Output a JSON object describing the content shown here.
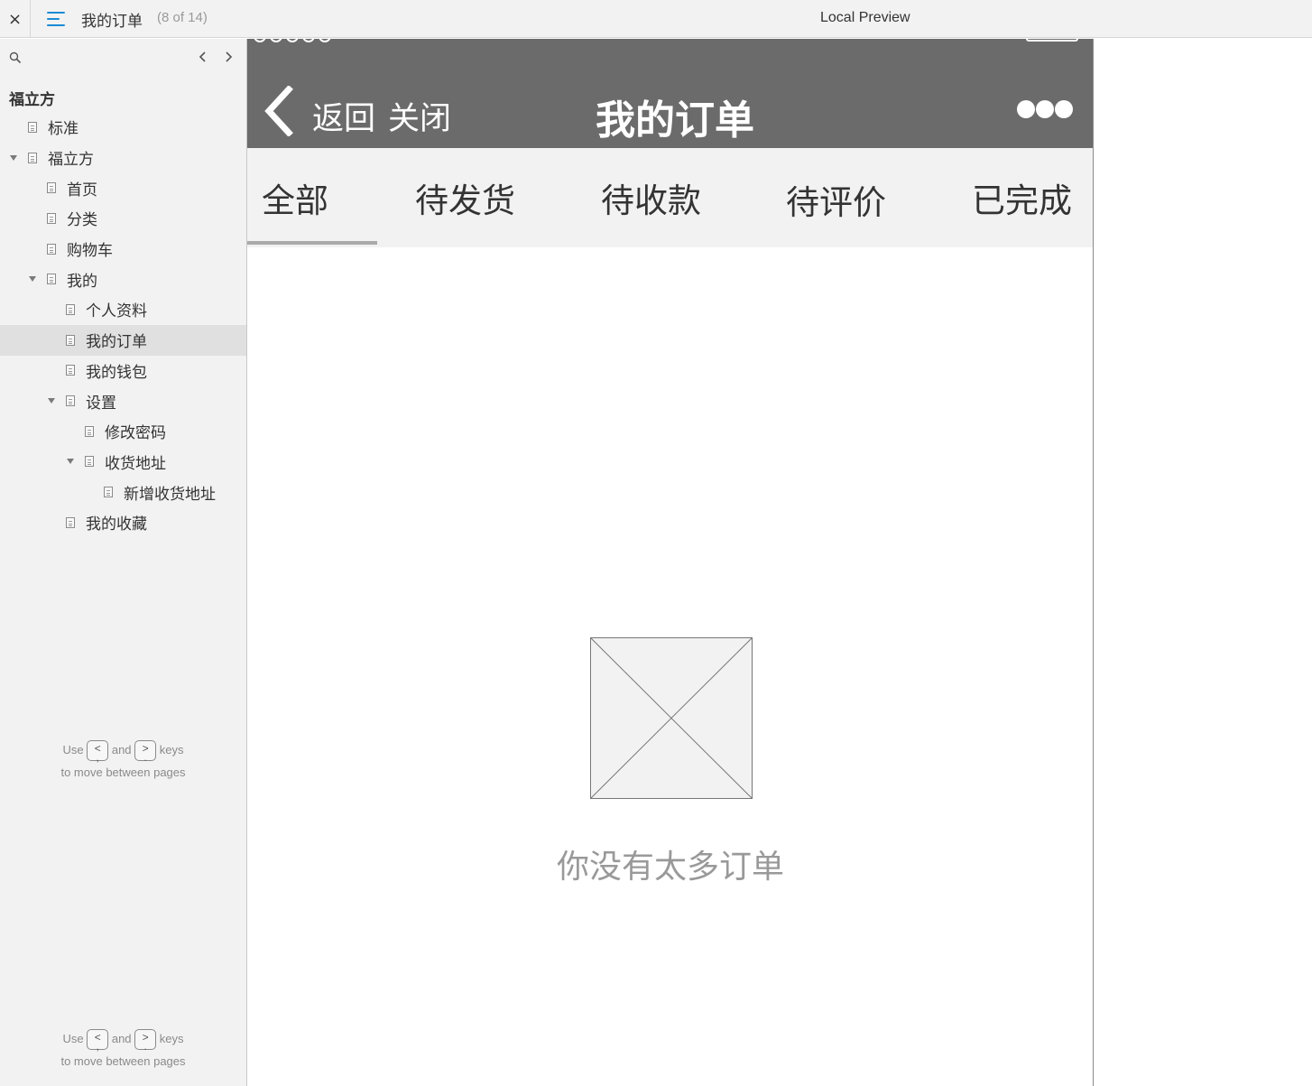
{
  "topbar": {
    "close_glyph": "×",
    "page_title": "我的订单",
    "page_count": "(8 of 14)",
    "preview_title": "Local Preview"
  },
  "sidebar": {
    "project_name": "福立方",
    "items": [
      {
        "label": "标准",
        "level": 1,
        "expandable": false,
        "selected": false
      },
      {
        "label": "福立方",
        "level": 1,
        "expandable": true,
        "selected": false
      },
      {
        "label": "首页",
        "level": 2,
        "expandable": false,
        "selected": false
      },
      {
        "label": "分类",
        "level": 2,
        "expandable": false,
        "selected": false
      },
      {
        "label": "购物车",
        "level": 2,
        "expandable": false,
        "selected": false
      },
      {
        "label": "我的",
        "level": 2,
        "expandable": true,
        "selected": false
      },
      {
        "label": "个人资料",
        "level": 3,
        "expandable": false,
        "selected": false
      },
      {
        "label": "我的订单",
        "level": 3,
        "expandable": false,
        "selected": true
      },
      {
        "label": "我的钱包",
        "level": 3,
        "expandable": false,
        "selected": false
      },
      {
        "label": "设置",
        "level": 3,
        "expandable": true,
        "selected": false
      },
      {
        "label": "修改密码",
        "level": 4,
        "expandable": false,
        "selected": false
      },
      {
        "label": "收货地址",
        "level": 4,
        "expandable": true,
        "selected": false
      },
      {
        "label": "新增收货地址",
        "level": 5,
        "expandable": false,
        "selected": false
      },
      {
        "label": "我的收藏",
        "level": 3,
        "expandable": false,
        "selected": false
      }
    ],
    "hint": {
      "use": "Use",
      "and": "and",
      "keys": "keys",
      "line2": "to move between pages",
      "key_left": "<",
      "key_left_sub": ",",
      "key_right": ">",
      "key_right_sub": "."
    }
  },
  "phone": {
    "nav": {
      "back_label": "返回",
      "close_label": "关闭",
      "title": "我的订单"
    },
    "tabs": [
      {
        "label": "全部",
        "active": true
      },
      {
        "label": "待发货",
        "active": false
      },
      {
        "label": "待收款",
        "active": false
      },
      {
        "label": "待评价",
        "active": false
      },
      {
        "label": "已完成",
        "active": false
      }
    ],
    "empty_message": "你没有太多订单"
  },
  "colors": {
    "navbar_bg": "#6b6b6b",
    "tabbar_bg": "#f2f2f2",
    "sidebar_bg": "#f2f2f2",
    "selected_bg": "#e0e0e0",
    "accent_menu": "#1a8bd6",
    "empty_text": "#999999"
  },
  "icons": {
    "close": "close-icon",
    "menu": "hamburger-menu-icon",
    "search": "search-icon",
    "prev": "chevron-left-icon",
    "next": "chevron-right-icon",
    "back": "back-chevron-icon",
    "more": "more-dots-icon",
    "placeholder": "image-placeholder-icon"
  }
}
